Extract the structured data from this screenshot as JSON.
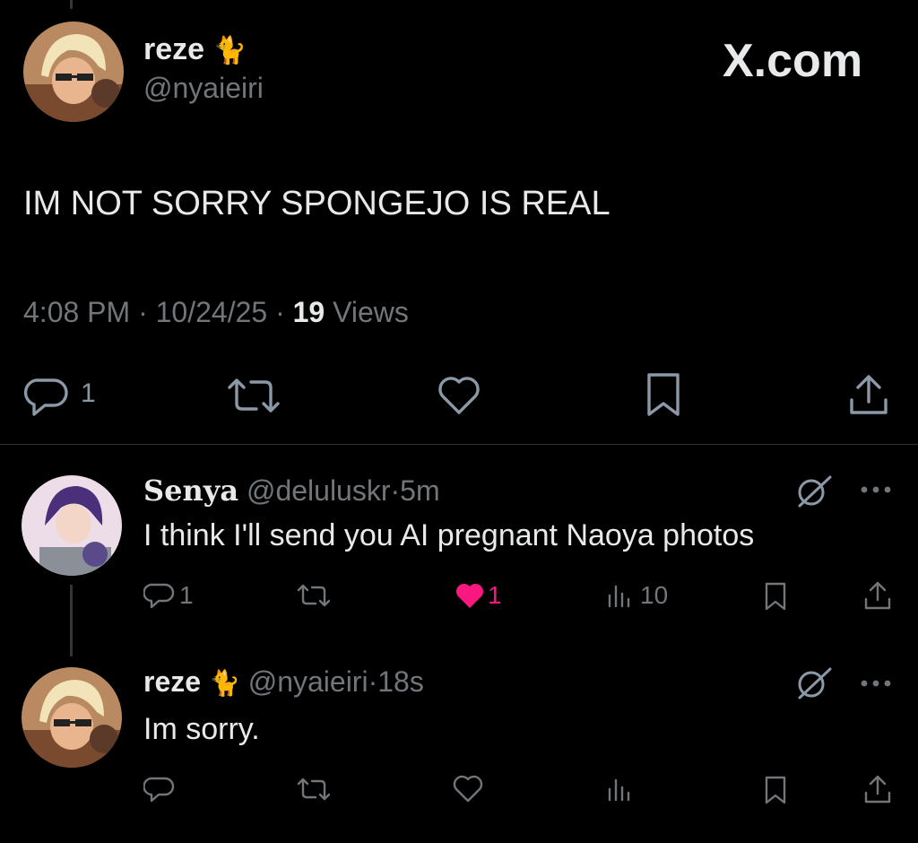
{
  "main_tweet": {
    "display_name": "reze",
    "handle": "@nyaieiri",
    "text": "IM NOT SORRY SPONGEJO IS REAL",
    "time": "4:08 PM",
    "date": "10/24/25",
    "views_count": "19",
    "views_label": "Views",
    "reply_count": "1",
    "watermark": "X.com"
  },
  "replies": [
    {
      "display_name": "Senya",
      "handle": "@deluluskr",
      "time": "5m",
      "text": "I think I'll send you AI pregnant Naoya photos",
      "reply_count": "1",
      "like_count": "1",
      "view_count": "10"
    },
    {
      "display_name": "reze",
      "handle": "@nyaieiri",
      "time": "18s",
      "text": "Im sorry."
    }
  ],
  "separator": "·",
  "colors": {
    "background": "#000000",
    "text": "#e7e9ea",
    "muted": "#71767b",
    "like": "#f91880"
  }
}
